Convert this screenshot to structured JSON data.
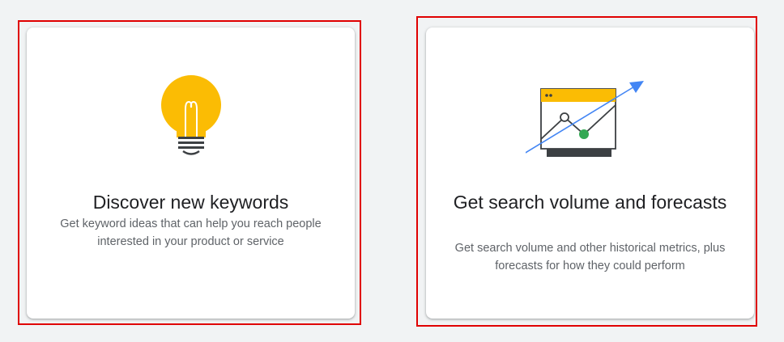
{
  "cards": [
    {
      "title": "Discover new keywords",
      "description": "Get keyword ideas that can help you reach people interested in your product or service",
      "icon": "lightbulb-icon"
    },
    {
      "title": "Get search volume and forecasts",
      "description": "Get search volume and other historical metrics, plus forecasts for how they could perform",
      "icon": "trend-chart-icon"
    }
  ],
  "colors": {
    "highlight_border": "#e00000",
    "accent_yellow": "#fbbc04",
    "accent_blue": "#4285f4",
    "accent_green": "#34a853",
    "dark_gray": "#3c4043"
  }
}
